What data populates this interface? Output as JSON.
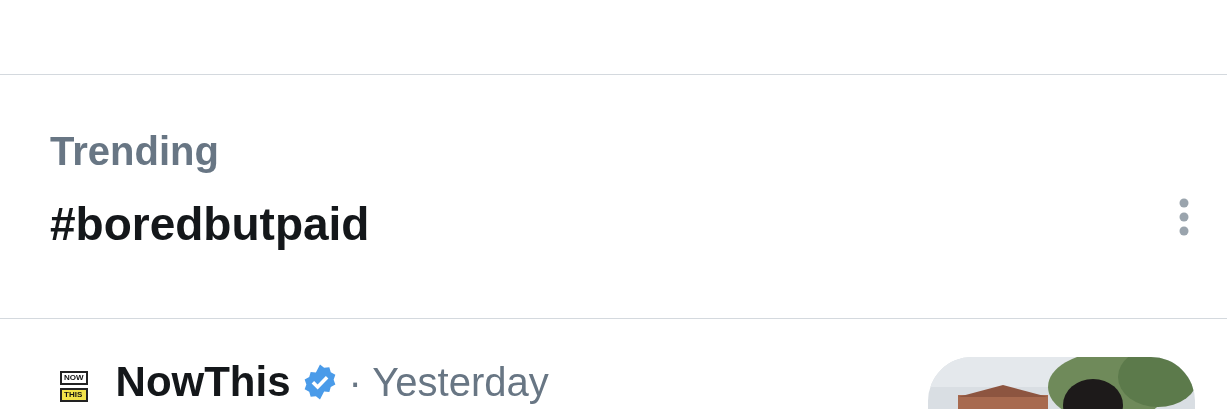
{
  "trend": {
    "label": "Trending",
    "hashtag": "#boredbutpaid"
  },
  "tweet": {
    "logo_top": "NOW",
    "logo_bottom": "THIS",
    "author": "NowThis",
    "verified": true,
    "time": "· Yesterday"
  }
}
